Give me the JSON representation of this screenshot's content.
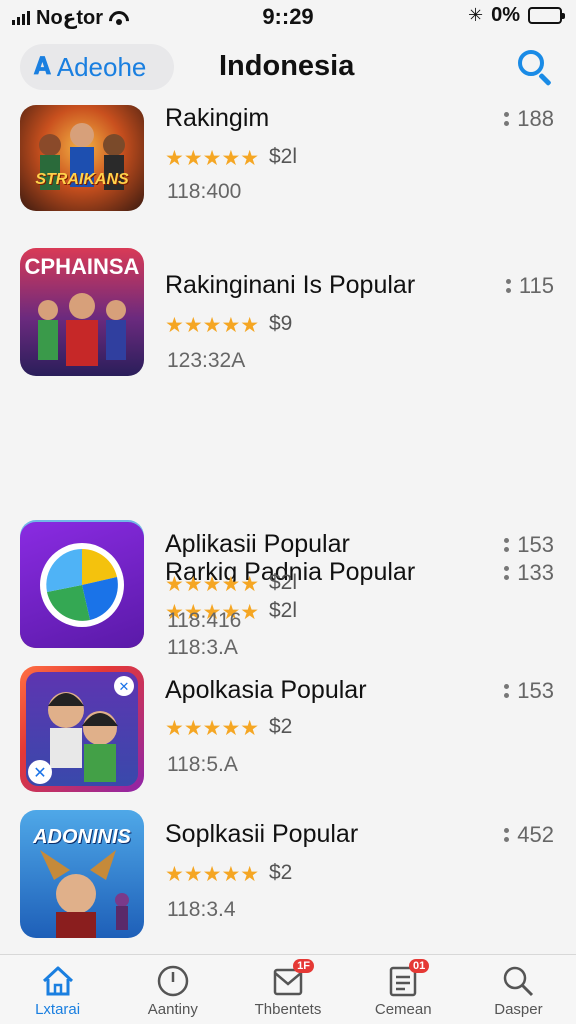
{
  "status": {
    "carrier": "Noعtor",
    "time": "9::29",
    "battery": "0%"
  },
  "header": {
    "back_label": "Adeohe",
    "title": "Indonesia"
  },
  "apps": [
    {
      "name": "Rakingim",
      "price": "$2l",
      "sub": "118:400",
      "count": "188",
      "rating": 5,
      "art": "STRAIKANS"
    },
    {
      "name": "Rakinginani Is Popular",
      "price": "$9",
      "sub": "123:32A",
      "count": "115",
      "rating": 5,
      "art": "CPHAINSA"
    },
    {
      "name": "Rarkig Padnia Popular",
      "price": "$2l",
      "sub": "118:3.A",
      "count": "133",
      "rating": 5,
      "art": ""
    },
    {
      "name": "Aplikasii Popular",
      "price": "$2l",
      "sub": "118:416",
      "count": "153",
      "rating": 5,
      "art": ""
    },
    {
      "name": "Apolkasia Popular",
      "price": "$2",
      "sub": "118:5.A",
      "count": "153",
      "rating": 5,
      "art": ""
    },
    {
      "name": "Soplkasii  Popular",
      "price": "$2",
      "sub": "118:3.4",
      "count": "452",
      "rating": 5,
      "art": "ADONINIS"
    }
  ],
  "tabs": [
    {
      "label": "Lxtarai",
      "icon": "home-icon",
      "active": true
    },
    {
      "label": "Aantiny",
      "icon": "clock-icon",
      "active": false
    },
    {
      "label": "Thbentets",
      "icon": "inbox-icon",
      "badge": "1F",
      "active": false
    },
    {
      "label": "Cemean",
      "icon": "document-icon",
      "badge": "01",
      "active": false
    },
    {
      "label": "Dasper",
      "icon": "search-icon",
      "active": false
    }
  ],
  "colors": {
    "accent": "#1a7fe0",
    "star": "#f5a623",
    "badge": "#e53935"
  }
}
